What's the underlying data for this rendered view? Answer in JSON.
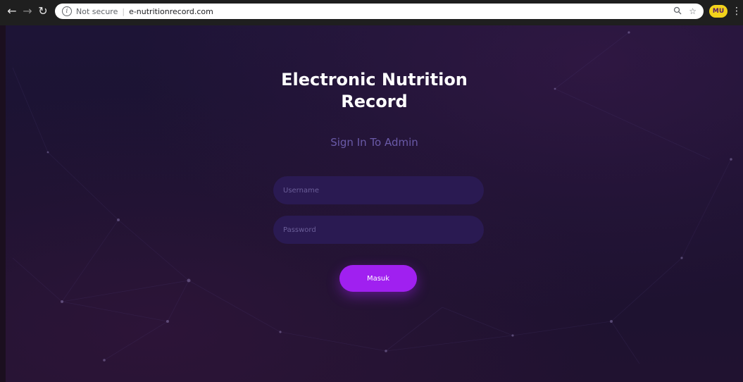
{
  "browser": {
    "security_label": "Not secure",
    "separator": "|",
    "url": "e-nutritionrecord.com",
    "avatar_text": "MU"
  },
  "login": {
    "title_line1": "Electronic Nutrition",
    "title_line2": "Record",
    "subtitle": "Sign In To Admin",
    "username_placeholder": "Username",
    "password_placeholder": "Password",
    "submit_label": "Masuk"
  },
  "colors": {
    "accent": "#a020f0",
    "background": "#1b1230",
    "input_bg": "#2a1a52",
    "subtitle": "#6a5aa8"
  },
  "icons": {
    "back": "arrow-left-icon",
    "forward": "arrow-right-icon",
    "reload": "reload-icon",
    "info": "info-icon",
    "zoom": "zoom-icon",
    "bookmark": "star-icon",
    "menu": "kebab-menu-icon"
  }
}
